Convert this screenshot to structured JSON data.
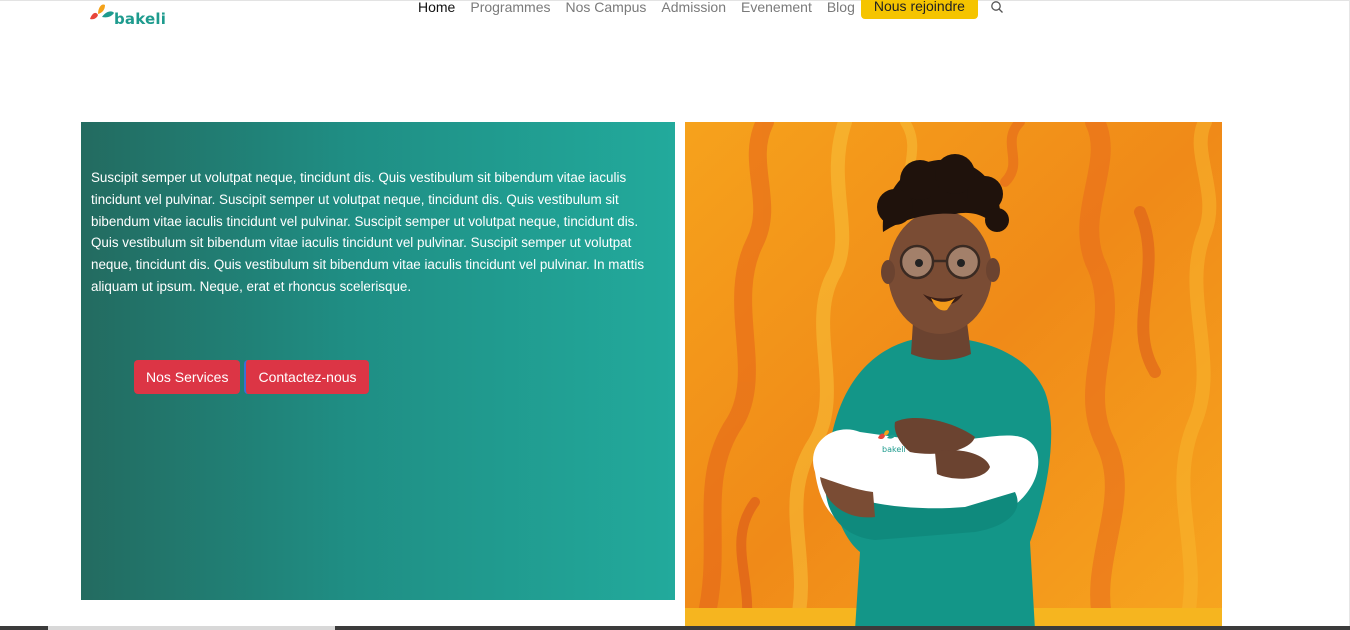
{
  "header": {
    "logo_text": "bakeli",
    "nav": [
      "Home",
      "Programmes",
      "Nos Campus",
      "Admission",
      "Evenement",
      "Blog"
    ],
    "join_label": "Nous rejoindre",
    "search_icon": "search-icon"
  },
  "hero": {
    "paragraph": "Suscipit semper ut volutpat neque, tincidunt dis. Quis vestibulum sit bibendum vitae iaculis tincidunt vel pulvinar. Suscipit semper ut volutpat neque, tincidunt dis. Quis vestibulum sit bibendum vitae iaculis tincidunt vel pulvinar. Suscipit semper ut volutpat neque, tincidunt dis. Quis vestibulum sit bibendum vitae iaculis tincidunt vel pulvinar. Suscipit semper ut volutpat neque, tincidunt dis. Quis vestibulum sit bibendum vitae iaculis tincidunt vel pulvinar. In mattis aliquam ut ipsum. Neque, erat et rhoncus scelerisque.",
    "services_label": "Nos Services",
    "contact_label": "Contactez-nous",
    "shirt_logo_text": "bakeli"
  },
  "colors": {
    "brand_teal": "#1e9b8e",
    "accent_yellow": "#f5c400",
    "button_red": "#dc3545",
    "flame_orange": "#f39a1a"
  }
}
